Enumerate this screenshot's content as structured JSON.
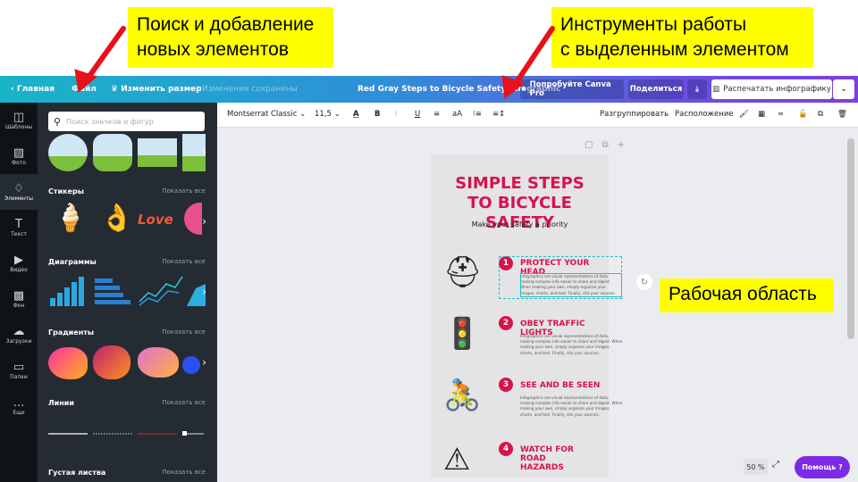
{
  "callouts": {
    "search_line1": "Поиск и добавление",
    "search_line2": "новых элементов",
    "tools_line1": "Инструменты работы",
    "tools_line2": "с выделенным элементом",
    "workspace": "Рабочая область"
  },
  "header": {
    "home": "Главная",
    "file": "Файл",
    "resize": "Изменить размер",
    "saved": "Изменения сохранены",
    "title": "Red Gray Steps to Bicycle Safety Infographic",
    "try_pro": "Попробуйте Canva Pro",
    "share": "Поделиться",
    "print": "Распечатать инфографику"
  },
  "rail": [
    "Шаблоны",
    "Фото",
    "Элементы",
    "Текст",
    "Видео",
    "Фон",
    "Загрузки",
    "Папки",
    "Еще"
  ],
  "panel": {
    "search_placeholder": "Поиск значков и фигур",
    "show_all": "Показать все",
    "sections": [
      "Стикеры",
      "Диаграммы",
      "Градиенты",
      "Линии",
      "Густая листва"
    ]
  },
  "toolbar": {
    "font": "Montserrat Classic",
    "size": "11,5",
    "bold": "B",
    "italic": "I",
    "underline": "U",
    "case": "aA",
    "ungroup": "Разгруппировать",
    "arrange": "Расположение"
  },
  "infographic": {
    "title1": "SIMPLE STEPS",
    "title2": "TO BICYCLE SAFETY",
    "subtitle": "Make your safety a priority",
    "body": "Infographics are visual representations of data, making complex info easier to share and digest. When making your own, simply organize your images, charts, and text. Finally, cite your sources.",
    "steps": [
      {
        "n": "1",
        "title": "PROTECT YOUR HEAD"
      },
      {
        "n": "2",
        "title": "OBEY TRAFFIC LIGHTS"
      },
      {
        "n": "3",
        "title": "SEE AND BE SEEN"
      },
      {
        "n": "4",
        "title": "WATCH FOR ROAD HAZARDS"
      }
    ]
  },
  "footer": {
    "zoom": "50 %",
    "help": "Помощь"
  },
  "colors": {
    "accent": "#d8124a",
    "callout": "#ffff00",
    "arrow": "#e8101a",
    "help": "#7d2ae8"
  }
}
